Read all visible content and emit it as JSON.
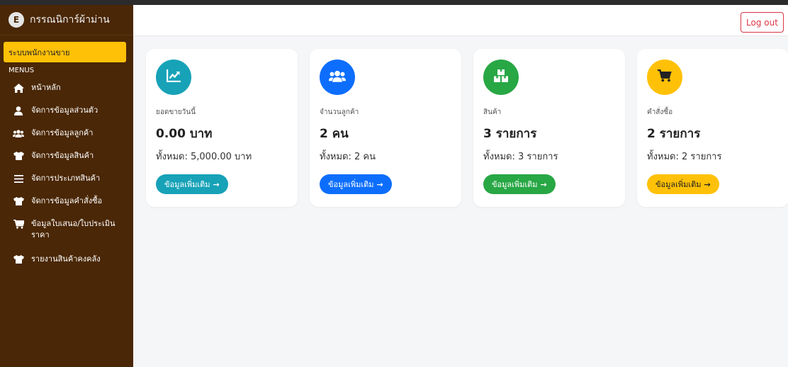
{
  "sidebar": {
    "brand_letter": "E",
    "brand_name": "กรรณนิการ์ผ้าม่าน",
    "role": "ระบบพนักงานขาย",
    "menus_title": "MENUS",
    "items": [
      {
        "label": "หน้าหลัก",
        "icon": "home-icon"
      },
      {
        "label": "จัดการข้อมูลส่วนตัว",
        "icon": "user-icon"
      },
      {
        "label": "จัดการข้อมูลลูกค้า",
        "icon": "users-icon"
      },
      {
        "label": "จัดการข้อมูลสินค้า",
        "icon": "shirt-icon"
      },
      {
        "label": "จัดการประเภทสินค้า",
        "icon": "list-icon"
      },
      {
        "label": "จัดการข้อมูลคำสั่งซื้อ",
        "icon": "shirt-icon"
      },
      {
        "label": "ข้อมูลใบเสนอ/ใบประเมินราคา",
        "icon": "cart-plus-icon"
      },
      {
        "label": "รายงานสินค้าคงคลัง",
        "icon": "shirt-icon"
      }
    ]
  },
  "header": {
    "logout_label": "Log out"
  },
  "cards": [
    {
      "title": "ยอดขายวันนี้",
      "value": "0.00 บาท",
      "total": "ทั้งหมด: 5,000.00 บาท",
      "button": "ข้อมูลเพิ่มเติม",
      "icon": "chart-line-icon",
      "color": "#17a2b8"
    },
    {
      "title": "จำนวนลูกค้า",
      "value": "2 คน",
      "total": "ทั้งหมด: 2 คน",
      "button": "ข้อมูลเพิ่มเติม",
      "icon": "users-icon",
      "color": "#0d6efd"
    },
    {
      "title": "สินค้า",
      "value": "3 รายการ",
      "total": "ทั้งหมด: 3 รายการ",
      "button": "ข้อมูลเพิ่มเติม",
      "icon": "boxes-icon",
      "color": "#28a745"
    },
    {
      "title": "คำสั่งซื้อ",
      "value": "2 รายการ",
      "total": "ทั้งหมด: 2 รายการ",
      "button": "ข้อมูลเพิ่มเติม",
      "icon": "cart-icon",
      "color": "#ffc107"
    }
  ],
  "colors": {
    "sidebar_bg": "#4a2706",
    "role_bg": "#ffc107",
    "logout": "#dc3545"
  }
}
